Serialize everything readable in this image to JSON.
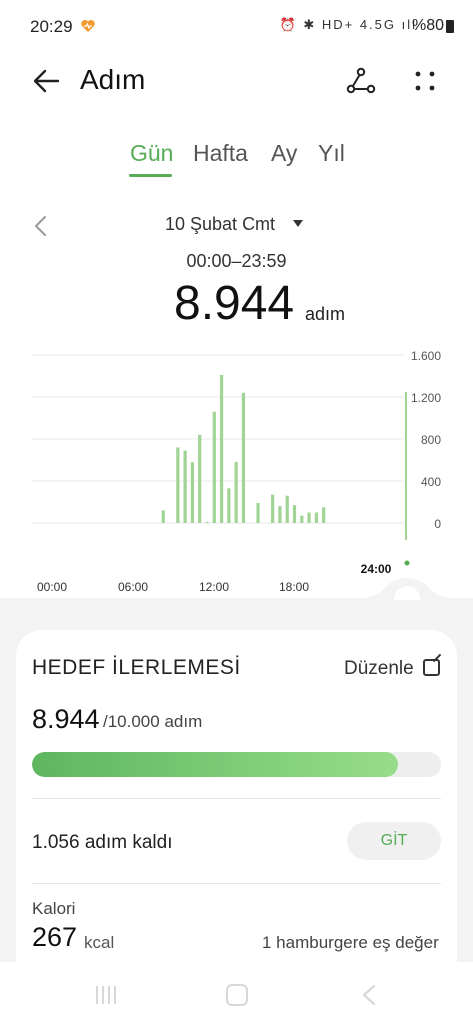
{
  "status": {
    "time": "20:29",
    "icons": "⏰ ✱ HD+ 4.5G ıll",
    "battery": "%80"
  },
  "appbar": {
    "title": "Adım"
  },
  "tabs": [
    {
      "label": "Gün",
      "active": true
    },
    {
      "label": "Hafta",
      "active": false
    },
    {
      "label": "Ay",
      "active": false
    },
    {
      "label": "Yıl",
      "active": false
    }
  ],
  "date": {
    "label": "10 Şubat Cmt",
    "range": "00:00–23:59"
  },
  "total": {
    "value": "8.944",
    "unit": "adım"
  },
  "chart_data": {
    "type": "bar",
    "x_ticks": [
      "00:00",
      "06:00",
      "12:00",
      "18:00"
    ],
    "x_end_label": "24:00",
    "y_ticks": [
      "1.600",
      "1.200",
      "800",
      "400",
      "0"
    ],
    "ylim": [
      0,
      1600
    ],
    "xlim": [
      0,
      24
    ],
    "bar_color": "#9fd494",
    "bars": [
      {
        "hour": 9.0,
        "value": 120
      },
      {
        "hour": 10.0,
        "value": 720
      },
      {
        "hour": 10.5,
        "value": 690
      },
      {
        "hour": 11.0,
        "value": 580
      },
      {
        "hour": 11.5,
        "value": 840
      },
      {
        "hour": 12.0,
        "value": 10
      },
      {
        "hour": 12.5,
        "value": 1060
      },
      {
        "hour": 13.0,
        "value": 1410
      },
      {
        "hour": 13.5,
        "value": 330
      },
      {
        "hour": 14.0,
        "value": 580
      },
      {
        "hour": 14.5,
        "value": 1240
      },
      {
        "hour": 15.5,
        "value": 190
      },
      {
        "hour": 16.5,
        "value": 270
      },
      {
        "hour": 17.0,
        "value": 160
      },
      {
        "hour": 17.5,
        "value": 260
      },
      {
        "hour": 18.0,
        "value": 170
      },
      {
        "hour": 18.5,
        "value": 70
      },
      {
        "hour": 19.0,
        "value": 100
      },
      {
        "hour": 19.5,
        "value": 100
      },
      {
        "hour": 20.0,
        "value": 150
      }
    ]
  },
  "goal": {
    "title": "HEDEF İLERLEMESİ",
    "edit_label": "Düzenle",
    "current": "8.944",
    "target_text": "/10.000 adım",
    "progress": 0.8944,
    "remaining": "1.056 adım kaldı",
    "go_label": "GİT"
  },
  "calories": {
    "label": "Kalori",
    "value": "267",
    "unit": "kcal",
    "equivalent": "1 hamburgere eş değer"
  },
  "colors": {
    "accent": "#56ad56",
    "bar": "#9fd494"
  }
}
